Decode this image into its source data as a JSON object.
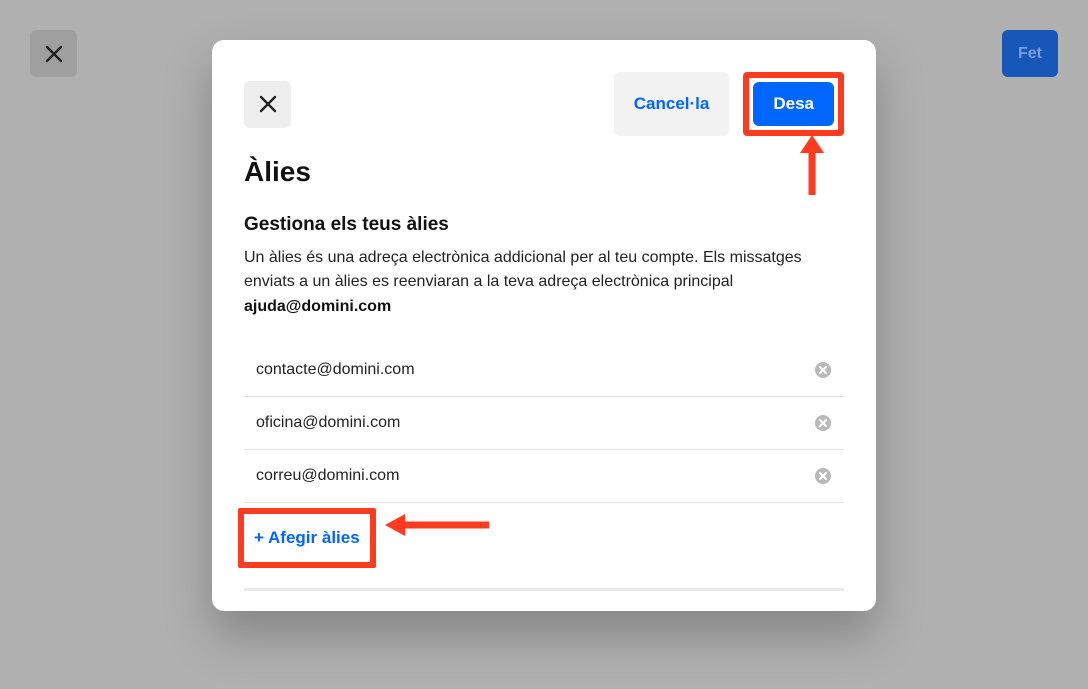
{
  "background": {
    "done_label": "Fet"
  },
  "modal": {
    "cancel_label": "Cancel·la",
    "save_label": "Desa",
    "title": "Àlies",
    "subtitle": "Gestiona els teus àlies",
    "description": "Un àlies és una adreça electrònica addicional per al teu compte. Els missatges enviats a un àlies es reenviaran a la teva adreça electrònica principal",
    "main_email": "ajuda@domini.com",
    "aliases": [
      {
        "email": "contacte@domini.com"
      },
      {
        "email": "oficina@domini.com"
      },
      {
        "email": "correu@domini.com"
      }
    ],
    "add_label": "+ Afegir àlies"
  },
  "annotations": {
    "highlight_save": true,
    "highlight_add": true
  }
}
